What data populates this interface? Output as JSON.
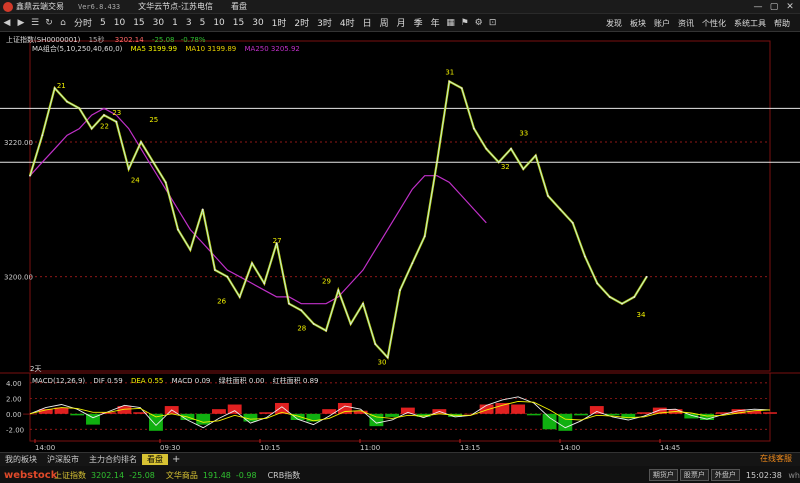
{
  "titlebar": {
    "app_name": "鑫鼎云端交易",
    "version": "Ver6.8.433",
    "server_node": "文华云节点-江苏电信",
    "mode_label": "看盘"
  },
  "toolbar": {
    "timeframes": [
      "分时",
      "5",
      "10",
      "15",
      "30",
      "1",
      "3",
      "5",
      "10",
      "15",
      "30",
      "1时",
      "2时",
      "3时",
      "4时",
      "日",
      "周",
      "月",
      "季",
      "年"
    ],
    "menu": [
      "发现",
      "板块",
      "账户",
      "资讯",
      "个性化",
      "系统工具",
      "帮助"
    ]
  },
  "chart_header": {
    "instrument": "上证指数(SH0000001)",
    "period": "15秒",
    "price": "3202.14",
    "change": "-25.08",
    "change_pct": "-0.78%",
    "ma_label": "MA组合(5,10,250,40,60,0)",
    "ma5": "MA5 3199.99",
    "ma10": "MA10 3199.89",
    "ma250": "MA250 3205.92"
  },
  "macd_header": {
    "label": "MACD(12,26,9)",
    "dif": "DIF 0.59",
    "dea": "DEA 0.55",
    "macd": "MACD 0.09",
    "green_area": "绿柱面积 0.00",
    "red_area": "红柱面积 0.89"
  },
  "price_axis_labels": [
    "3220.00",
    "3200.00"
  ],
  "macd_axis_labels": [
    "4.00",
    "2.00",
    "0.00",
    "-2.00"
  ],
  "time_labels": [
    "14:00",
    "09:30",
    "10:15",
    "11:00",
    "13:15",
    "14:00",
    "14:45"
  ],
  "bottom_left_label": "2天",
  "chart_data": {
    "type": "line",
    "title": "上证指数 15秒",
    "ylim": [
      3186,
      3235
    ],
    "x": [
      0,
      4,
      8,
      12,
      16,
      20,
      24,
      28,
      32,
      36,
      40,
      44,
      48,
      52,
      56,
      60,
      64,
      68,
      72,
      76,
      80,
      84,
      88,
      92,
      96,
      100,
      104,
      108,
      112,
      116,
      120,
      124,
      128,
      132,
      136,
      140,
      144,
      148,
      152,
      156,
      160,
      164,
      168,
      172,
      176,
      180,
      184,
      188,
      192,
      196,
      200,
      204,
      208,
      212,
      216,
      220,
      224,
      228,
      232,
      236,
      240
    ],
    "series": [
      {
        "name": "Price",
        "color": "#e8e8e8",
        "values": [
          3215,
          3221,
          3228,
          3226,
          3225,
          3222,
          3224,
          3223,
          3216,
          3220,
          3217,
          3214,
          3207,
          3204,
          3210,
          3201,
          3200,
          3197,
          3202,
          3199,
          3205,
          3196,
          3195,
          3193,
          3192,
          3198,
          3193,
          3196,
          3190,
          3188,
          3198,
          3202,
          3206,
          3217,
          3229,
          3228,
          3222,
          3219,
          3217,
          3219,
          3216,
          3218,
          3212,
          3210,
          3208,
          3203,
          3199,
          3197,
          3196,
          3197,
          3200
        ]
      },
      {
        "name": "MA250",
        "color": "#c030c8",
        "values": [
          3215,
          3217,
          3219,
          3221,
          3222,
          3224,
          3225,
          3224,
          3222,
          3219,
          3216,
          3213,
          3210,
          3207,
          3205,
          3203,
          3201,
          3200,
          3199,
          3198,
          3197,
          3197,
          3196,
          3196,
          3196,
          3197,
          3199,
          3201,
          3204,
          3207,
          3210,
          3213,
          3215,
          3215,
          3214,
          3212,
          3210,
          3208
        ]
      }
    ],
    "wave_labels": [
      {
        "text": "21",
        "x": 10,
        "y": 3228
      },
      {
        "text": "22",
        "x": 24,
        "y": 3222
      },
      {
        "text": "23",
        "x": 28,
        "y": 3224
      },
      {
        "text": "25",
        "x": 40,
        "y": 3223
      },
      {
        "text": "24",
        "x": 34,
        "y": 3214
      },
      {
        "text": "26",
        "x": 62,
        "y": 3196
      },
      {
        "text": "27",
        "x": 80,
        "y": 3205
      },
      {
        "text": "28",
        "x": 88,
        "y": 3192
      },
      {
        "text": "29",
        "x": 96,
        "y": 3199
      },
      {
        "text": "30",
        "x": 114,
        "y": 3187
      },
      {
        "text": "31",
        "x": 136,
        "y": 3230
      },
      {
        "text": "32",
        "x": 154,
        "y": 3216
      },
      {
        "text": "33",
        "x": 160,
        "y": 3221
      },
      {
        "text": "34",
        "x": 198,
        "y": 3194
      }
    ],
    "horizontal_lines": [
      3225,
      3217
    ],
    "dashed_levels": [
      3220,
      3200
    ],
    "macd_ylim": [
      -3,
      4.5
    ],
    "macd_dif": [
      0,
      0.8,
      1.2,
      0.6,
      -0.5,
      0.3,
      1.1,
      0.8,
      -1.5,
      0.5,
      -0.8,
      -1.8,
      -0.6,
      0.4,
      -1.2,
      -0.5,
      0.9,
      -0.7,
      -1.4,
      -0.3,
      1.0,
      0.6,
      -1.2,
      -0.8,
      0.2,
      -0.5,
      0.3,
      -0.4,
      -0.2,
      1.1,
      1.8,
      2.2,
      1.4,
      -0.5,
      -1.8,
      -0.9,
      0.3,
      -0.4,
      -0.8,
      -0.3,
      0.5,
      0.6,
      -0.2,
      -0.7,
      -0.1,
      0.4,
      0.6,
      0.5
    ],
    "macd_dea": [
      0,
      0.5,
      0.8,
      0.7,
      0.2,
      0.2,
      0.6,
      0.7,
      -0.4,
      0.0,
      -0.4,
      -1.1,
      -0.9,
      -0.2,
      -0.7,
      -0.6,
      0.2,
      -0.3,
      -0.9,
      -0.6,
      0.3,
      0.4,
      -0.4,
      -0.6,
      -0.2,
      -0.3,
      0.0,
      -0.2,
      -0.2,
      0.5,
      1.1,
      1.6,
      1.5,
      0.5,
      -0.7,
      -0.8,
      -0.2,
      -0.3,
      -0.5,
      -0.4,
      0.1,
      0.3,
      0.1,
      -0.3,
      -0.2,
      0.1,
      0.4,
      0.5
    ],
    "macd_hist": [
      0,
      0.6,
      0.8,
      -0.2,
      -1.4,
      0.2,
      1.0,
      0.2,
      -2.2,
      1.0,
      -0.8,
      -1.4,
      0.6,
      1.2,
      -1.0,
      0.2,
      1.4,
      -0.8,
      -1.0,
      0.6,
      1.4,
      0.4,
      -1.6,
      -0.4,
      0.8,
      -0.4,
      0.6,
      -0.4,
      0.0,
      1.2,
      1.4,
      1.2,
      -0.2,
      -2.0,
      -2.2,
      -0.2,
      1.0,
      -0.2,
      -0.6,
      0.2,
      0.8,
      0.6,
      -0.6,
      -0.8,
      0.2,
      0.6,
      0.4,
      0.2
    ]
  },
  "tabs": [
    "我的板块",
    "沪深股市",
    "主力合约排名",
    "看盘"
  ],
  "active_tab": "看盘",
  "online_service": "在线客服",
  "quote": {
    "logo": "webstock",
    "index1_name": "上证指数",
    "index1_value": "3202.14",
    "index1_change": "-25.08",
    "index2_name": "文华商品",
    "index2_value": "191.48",
    "index2_change": "-0.98",
    "index3_name": "CRB指数",
    "btn1": "期货户",
    "btn2": "股票户",
    "btn3": "外盘户",
    "time": "15:02:38",
    "time_suffix": "wh"
  },
  "colors": {
    "price_line": "#e8e8e8",
    "ma5": "#f2f200",
    "ma10": "#e8d000",
    "ma250": "#c030c8",
    "macd_up": "#e02020",
    "macd_down": "#10b010",
    "axis_red": "#c02020",
    "quote_down": "#30c030"
  }
}
